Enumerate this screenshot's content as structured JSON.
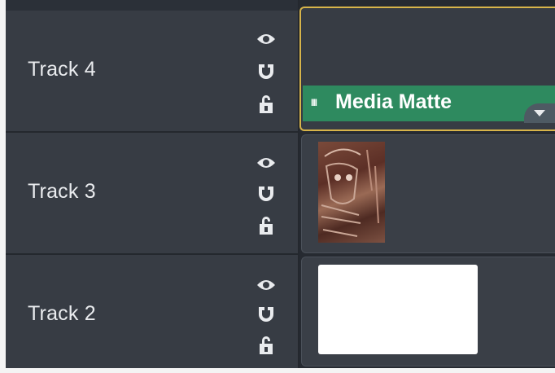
{
  "tracks": [
    {
      "name": "Track 4"
    },
    {
      "name": "Track 3"
    },
    {
      "name": "Track 2"
    }
  ],
  "clips": {
    "matte_label": "Media Matte"
  },
  "icons": {
    "visibility": "eye-icon",
    "magnet": "magnet-icon",
    "lock": "unlock-icon",
    "grip": "grip-icon",
    "menu": "triangle-down-icon"
  },
  "colors": {
    "header_bg": "#373c44",
    "lane_bg": "#3a3f47",
    "selection_border": "#d7b44a",
    "matte_clip": "#2e8a5f",
    "text": "#e9ebee"
  }
}
